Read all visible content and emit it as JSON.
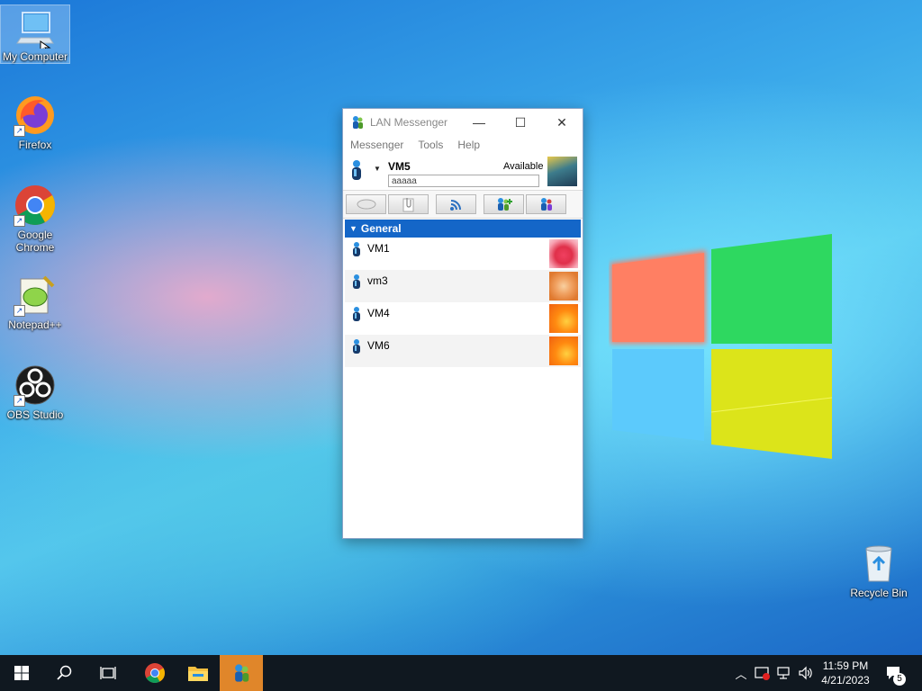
{
  "desktop": {
    "icons": [
      {
        "label": "My Computer",
        "icon": "computer-icon"
      },
      {
        "label": "Firefox",
        "icon": "firefox-icon"
      },
      {
        "label": "Google Chrome",
        "icon": "chrome-icon"
      },
      {
        "label": "Notepad++",
        "icon": "notepadpp-icon"
      },
      {
        "label": "OBS Studio",
        "icon": "obs-icon"
      }
    ],
    "recycle_bin": {
      "label": "Recycle Bin",
      "icon": "recycle-bin-icon"
    }
  },
  "window": {
    "title": "LAN Messenger",
    "controls": {
      "minimize": "—",
      "maximize": "☐",
      "close": "✕"
    },
    "menu": [
      "Messenger",
      "Tools",
      "Help"
    ],
    "profile": {
      "name": "VM5",
      "status": "Available",
      "note": "aaaaa"
    },
    "toolbar": [
      "chat-icon",
      "attach-file-icon",
      "broadcast-icon",
      "add-contact-icon",
      "settings-icon"
    ],
    "group": {
      "name": "General"
    },
    "contacts": [
      {
        "name": "VM1",
        "avatar": "red-starfish"
      },
      {
        "name": "vm3",
        "avatar": "orange-starfish"
      },
      {
        "name": "VM4",
        "avatar": "orange-flower"
      },
      {
        "name": "VM6",
        "avatar": "orange-flower"
      }
    ]
  },
  "taskbar": {
    "apps": [
      "start-icon",
      "search-icon",
      "task-view-icon",
      "chrome-icon",
      "file-explorer-icon",
      "lan-messenger-icon"
    ],
    "clock": {
      "time": "11:59 PM",
      "date": "4/21/2023"
    },
    "notification_count": "5"
  },
  "colors": {
    "accent": "#1466c8",
    "taskbar": "#101820",
    "active_app": "#e0862a"
  }
}
